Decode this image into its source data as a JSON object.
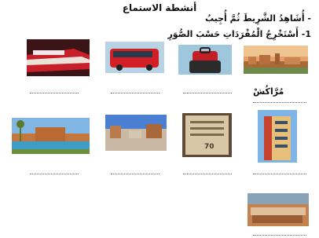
{
  "header": {
    "title": "أنشطة الاستماع",
    "instruction_listen": "- أُشَاهِدُ الشَّرِيطَ ثُمَّ أُجِيبُ",
    "instruction_extract": "1- أَسْتَخْرِجُ الْمُفْرَدَاتِ حَسْبَ الصُّوَرِ"
  },
  "city_word": "مُرَّاكُشْ",
  "images": [
    {
      "id": "city-panorama",
      "subject": "city"
    },
    {
      "id": "luggage",
      "subject": "luggage"
    },
    {
      "id": "bus",
      "subject": "bus"
    },
    {
      "id": "train",
      "subject": "train"
    },
    {
      "id": "hotel-building",
      "subject": "hotel"
    },
    {
      "id": "plaque",
      "subject": "plaque"
    },
    {
      "id": "square",
      "subject": "square"
    },
    {
      "id": "garden-pool",
      "subject": "garden"
    },
    {
      "id": "market",
      "subject": "market"
    }
  ],
  "answer_blank": "............................",
  "plaque_text": "70"
}
